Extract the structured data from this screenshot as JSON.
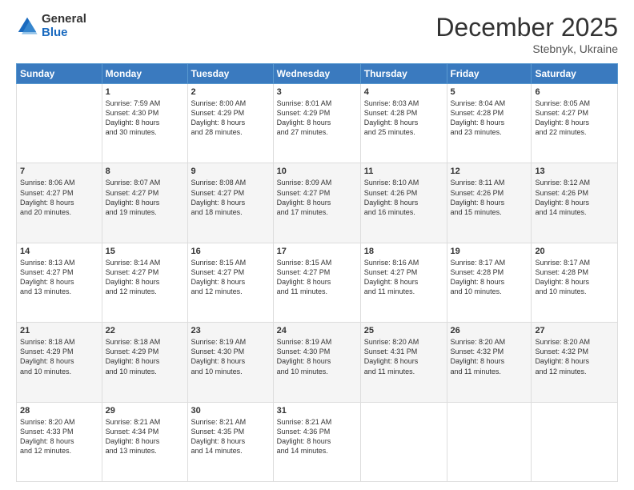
{
  "header": {
    "logo_general": "General",
    "logo_blue": "Blue",
    "month_title": "December 2025",
    "location": "Stebnyk, Ukraine"
  },
  "days_of_week": [
    "Sunday",
    "Monday",
    "Tuesday",
    "Wednesday",
    "Thursday",
    "Friday",
    "Saturday"
  ],
  "weeks": [
    [
      {
        "day": "",
        "info": ""
      },
      {
        "day": "1",
        "info": "Sunrise: 7:59 AM\nSunset: 4:30 PM\nDaylight: 8 hours\nand 30 minutes."
      },
      {
        "day": "2",
        "info": "Sunrise: 8:00 AM\nSunset: 4:29 PM\nDaylight: 8 hours\nand 28 minutes."
      },
      {
        "day": "3",
        "info": "Sunrise: 8:01 AM\nSunset: 4:29 PM\nDaylight: 8 hours\nand 27 minutes."
      },
      {
        "day": "4",
        "info": "Sunrise: 8:03 AM\nSunset: 4:28 PM\nDaylight: 8 hours\nand 25 minutes."
      },
      {
        "day": "5",
        "info": "Sunrise: 8:04 AM\nSunset: 4:28 PM\nDaylight: 8 hours\nand 23 minutes."
      },
      {
        "day": "6",
        "info": "Sunrise: 8:05 AM\nSunset: 4:27 PM\nDaylight: 8 hours\nand 22 minutes."
      }
    ],
    [
      {
        "day": "7",
        "info": "Sunrise: 8:06 AM\nSunset: 4:27 PM\nDaylight: 8 hours\nand 20 minutes."
      },
      {
        "day": "8",
        "info": "Sunrise: 8:07 AM\nSunset: 4:27 PM\nDaylight: 8 hours\nand 19 minutes."
      },
      {
        "day": "9",
        "info": "Sunrise: 8:08 AM\nSunset: 4:27 PM\nDaylight: 8 hours\nand 18 minutes."
      },
      {
        "day": "10",
        "info": "Sunrise: 8:09 AM\nSunset: 4:27 PM\nDaylight: 8 hours\nand 17 minutes."
      },
      {
        "day": "11",
        "info": "Sunrise: 8:10 AM\nSunset: 4:26 PM\nDaylight: 8 hours\nand 16 minutes."
      },
      {
        "day": "12",
        "info": "Sunrise: 8:11 AM\nSunset: 4:26 PM\nDaylight: 8 hours\nand 15 minutes."
      },
      {
        "day": "13",
        "info": "Sunrise: 8:12 AM\nSunset: 4:26 PM\nDaylight: 8 hours\nand 14 minutes."
      }
    ],
    [
      {
        "day": "14",
        "info": "Sunrise: 8:13 AM\nSunset: 4:27 PM\nDaylight: 8 hours\nand 13 minutes."
      },
      {
        "day": "15",
        "info": "Sunrise: 8:14 AM\nSunset: 4:27 PM\nDaylight: 8 hours\nand 12 minutes."
      },
      {
        "day": "16",
        "info": "Sunrise: 8:15 AM\nSunset: 4:27 PM\nDaylight: 8 hours\nand 12 minutes."
      },
      {
        "day": "17",
        "info": "Sunrise: 8:15 AM\nSunset: 4:27 PM\nDaylight: 8 hours\nand 11 minutes."
      },
      {
        "day": "18",
        "info": "Sunrise: 8:16 AM\nSunset: 4:27 PM\nDaylight: 8 hours\nand 11 minutes."
      },
      {
        "day": "19",
        "info": "Sunrise: 8:17 AM\nSunset: 4:28 PM\nDaylight: 8 hours\nand 10 minutes."
      },
      {
        "day": "20",
        "info": "Sunrise: 8:17 AM\nSunset: 4:28 PM\nDaylight: 8 hours\nand 10 minutes."
      }
    ],
    [
      {
        "day": "21",
        "info": "Sunrise: 8:18 AM\nSunset: 4:29 PM\nDaylight: 8 hours\nand 10 minutes."
      },
      {
        "day": "22",
        "info": "Sunrise: 8:18 AM\nSunset: 4:29 PM\nDaylight: 8 hours\nand 10 minutes."
      },
      {
        "day": "23",
        "info": "Sunrise: 8:19 AM\nSunset: 4:30 PM\nDaylight: 8 hours\nand 10 minutes."
      },
      {
        "day": "24",
        "info": "Sunrise: 8:19 AM\nSunset: 4:30 PM\nDaylight: 8 hours\nand 10 minutes."
      },
      {
        "day": "25",
        "info": "Sunrise: 8:20 AM\nSunset: 4:31 PM\nDaylight: 8 hours\nand 11 minutes."
      },
      {
        "day": "26",
        "info": "Sunrise: 8:20 AM\nSunset: 4:32 PM\nDaylight: 8 hours\nand 11 minutes."
      },
      {
        "day": "27",
        "info": "Sunrise: 8:20 AM\nSunset: 4:32 PM\nDaylight: 8 hours\nand 12 minutes."
      }
    ],
    [
      {
        "day": "28",
        "info": "Sunrise: 8:20 AM\nSunset: 4:33 PM\nDaylight: 8 hours\nand 12 minutes."
      },
      {
        "day": "29",
        "info": "Sunrise: 8:21 AM\nSunset: 4:34 PM\nDaylight: 8 hours\nand 13 minutes."
      },
      {
        "day": "30",
        "info": "Sunrise: 8:21 AM\nSunset: 4:35 PM\nDaylight: 8 hours\nand 14 minutes."
      },
      {
        "day": "31",
        "info": "Sunrise: 8:21 AM\nSunset: 4:36 PM\nDaylight: 8 hours\nand 14 minutes."
      },
      {
        "day": "",
        "info": ""
      },
      {
        "day": "",
        "info": ""
      },
      {
        "day": "",
        "info": ""
      }
    ]
  ],
  "row_colors": [
    "white",
    "gray",
    "white",
    "gray",
    "white"
  ]
}
